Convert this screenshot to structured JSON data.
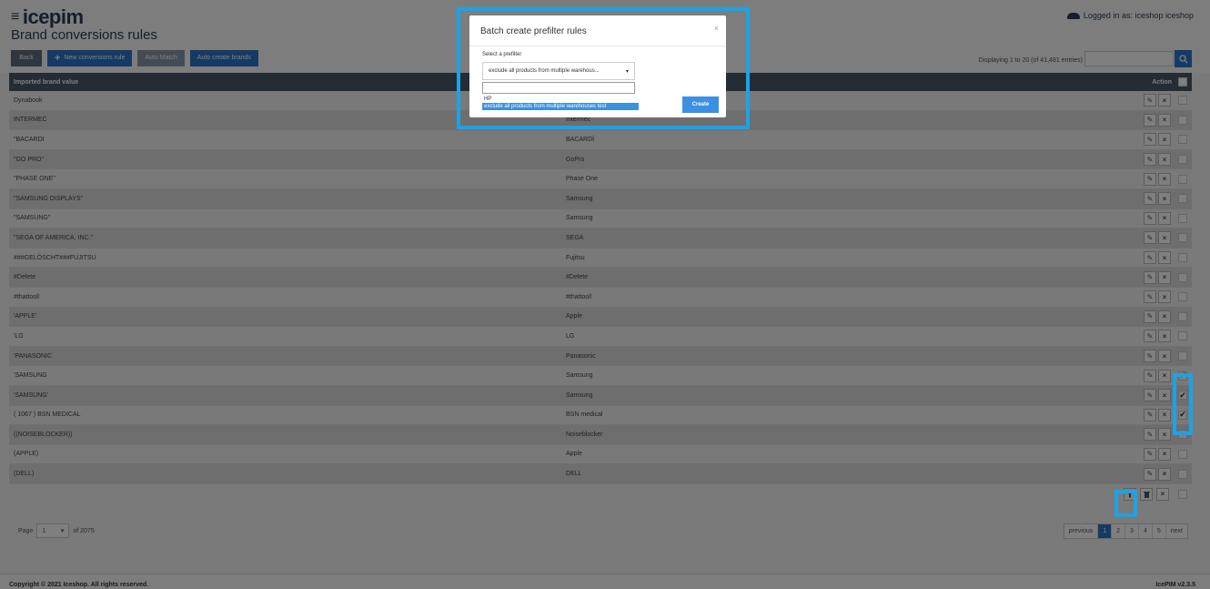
{
  "app": {
    "logo": "icepim",
    "page_title": "Brand conversions rules",
    "logged_in": "Logged in as: iceshop iceshop"
  },
  "toolbar": {
    "back": "Back",
    "new_rule": "New conversions rule",
    "auto_match": "Auto Match",
    "auto_create": "Auto create brands"
  },
  "search": {
    "displaying": "Displaying 1 to 20 (of 41,481 entries)",
    "placeholder": ""
  },
  "table": {
    "columns": [
      "Imported brand value",
      "",
      "Action"
    ],
    "rows": [
      {
        "imported": "Dynabook",
        "brand": "",
        "checked": false
      },
      {
        "imported": "INTERMEC",
        "brand": "Intermec",
        "checked": false
      },
      {
        "imported": "\"BACARDI",
        "brand": "BACARDÍ",
        "checked": false
      },
      {
        "imported": "\"GO PRO\"",
        "brand": "GoPro",
        "checked": false
      },
      {
        "imported": "\"PHASE ONE\"",
        "brand": "Phase One",
        "checked": false
      },
      {
        "imported": "\"SAMSUNG DISPLAYS\"",
        "brand": "Samsung",
        "checked": false
      },
      {
        "imported": "\"SAMSUNG\"",
        "brand": "Samsung",
        "checked": false
      },
      {
        "imported": "\"SEGA OF AMERICA, INC.\"",
        "brand": "SEGA",
        "checked": false
      },
      {
        "imported": "###GELÖSCHT###FUJITSU",
        "brand": "Fujitsu",
        "checked": false
      },
      {
        "imported": "#Delete",
        "brand": "#Delete",
        "checked": false
      },
      {
        "imported": "#thattool!",
        "brand": "#thattool!",
        "checked": false
      },
      {
        "imported": "'APPLE'",
        "brand": "Apple",
        "checked": false
      },
      {
        "imported": "'LG",
        "brand": "LG",
        "checked": false
      },
      {
        "imported": "'PANASONIC",
        "brand": "Panasonic",
        "checked": false
      },
      {
        "imported": "'SAMSUNG",
        "brand": "Samsung",
        "checked": true
      },
      {
        "imported": "'SAMSUNG'",
        "brand": "Samsung",
        "checked": true
      },
      {
        "imported": "( 1067 ) BSN MEDICAL",
        "brand": "BSN medical",
        "checked": true
      },
      {
        "imported": "((NOISEBLOCKER))",
        "brand": "Noiseblocker",
        "checked": false
      },
      {
        "imported": "(APPLE)",
        "brand": "Apple",
        "checked": false
      },
      {
        "imported": "(DELL)",
        "brand": "DELL",
        "checked": false
      }
    ]
  },
  "pager": {
    "page_label": "Page",
    "page_value": "1",
    "of_label": "of 2075",
    "previous": "previous",
    "pages": [
      "1",
      "2",
      "3",
      "4",
      "5"
    ],
    "next": "next"
  },
  "footer": {
    "copyright": "Copyright © 2021 Iceshop. All rights reserved.",
    "version": "IcePIM v2.3.5"
  },
  "modal": {
    "title": "Batch create prefilter rules",
    "close": "×",
    "label": "Select a prefilter",
    "selected": "exclude all products from multiple warehous...",
    "options": [
      "HP",
      "exclude all products from multiple warehouses test"
    ],
    "create": "Create"
  },
  "colors": {
    "accent": "#2d74c8",
    "highlight": "#1aa3e8",
    "header_dark": "#4a5868"
  }
}
